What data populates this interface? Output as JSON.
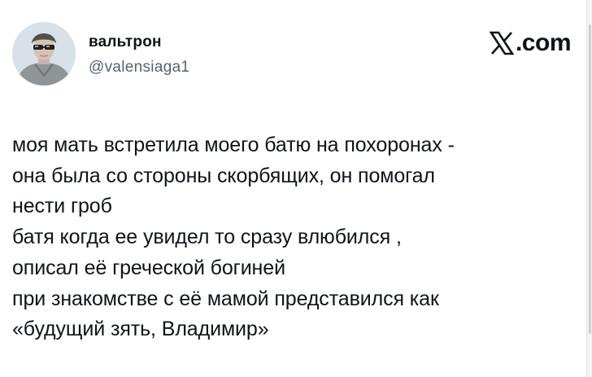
{
  "author": {
    "display_name": "вальтрон",
    "handle": "@valensiaga1",
    "avatar_icon": "avatar-photo"
  },
  "brand": {
    "logo_icon": "x-logo-icon",
    "suffix": ".com"
  },
  "tweet": {
    "lines": [
      "моя мать встретила моего батю на похоронах -",
      "она была со стороны скорбящих, он помогал",
      "нести гроб",
      "батя когда ее увидел то сразу влюбился ,",
      "описал её греческой богиней",
      "при знакомстве с её мамой представился как",
      "«будущий зять, Владимир»"
    ]
  },
  "colors": {
    "text_primary": "#0f1419",
    "text_secondary": "#536471",
    "background": "#ffffff"
  }
}
